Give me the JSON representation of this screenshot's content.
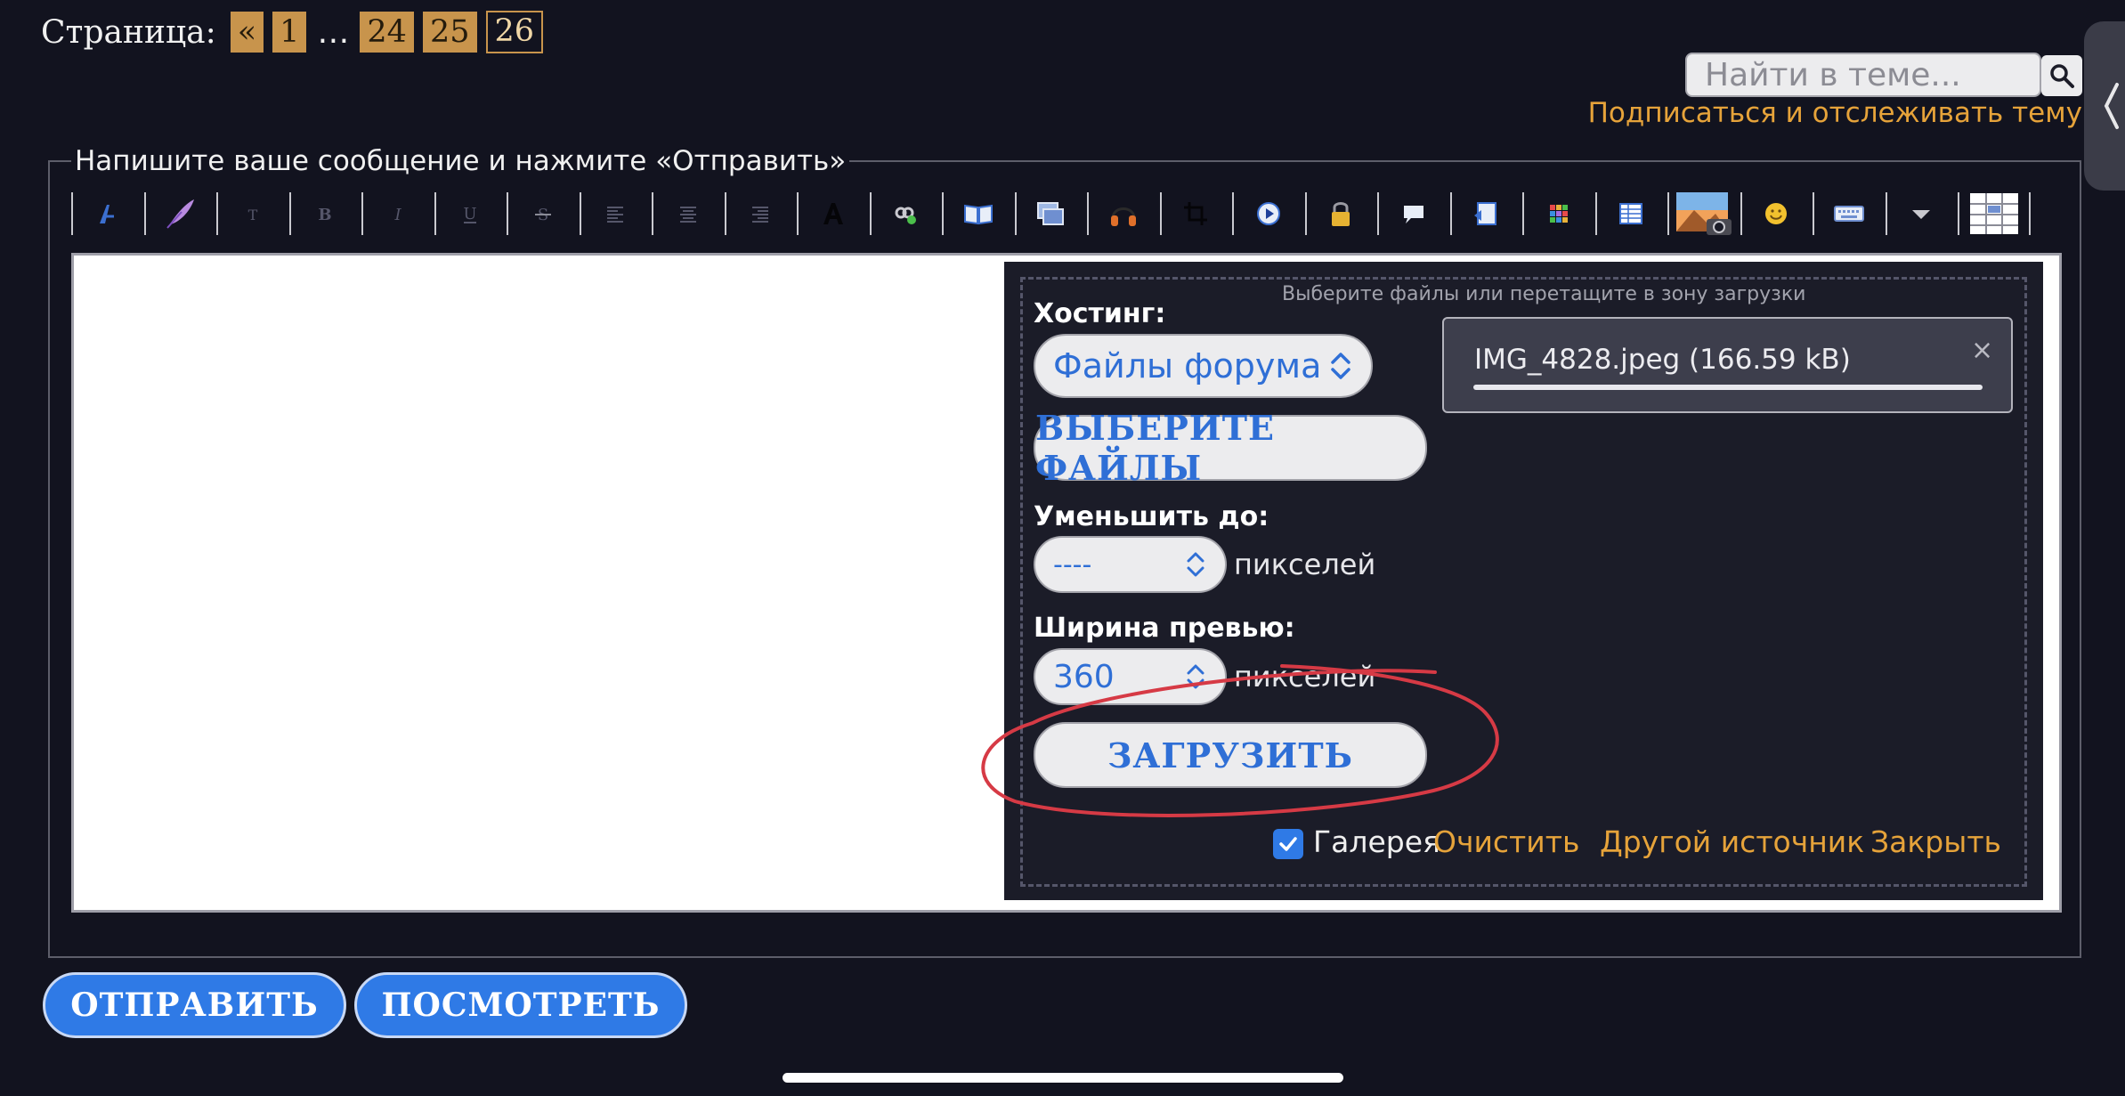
{
  "pagination": {
    "label": "Страница:",
    "prev": "«",
    "pages": [
      "1",
      "…",
      "24",
      "25",
      "26"
    ],
    "current": "26"
  },
  "search": {
    "placeholder": "Найти в теме..."
  },
  "subscribe": {
    "label": "Подписаться и отслеживать тему"
  },
  "form": {
    "legend": "Напишите ваше сообщение и нажмите «Отправить»"
  },
  "toolbar": {
    "icons": [
      "font-style-icon",
      "quill-icon",
      "text-size-icon",
      "bold-icon",
      "italic-icon",
      "underline-icon",
      "strikethrough-icon",
      "align-left-icon",
      "align-center-icon",
      "align-right-icon",
      "font-color-icon",
      "link-icon",
      "book-icon",
      "window-icon",
      "headphones-icon",
      "crop-icon",
      "play-icon",
      "lock-icon",
      "speech-bubble-icon",
      "code-icon",
      "grid-icon",
      "table-icon",
      "photo-icon",
      "smiley-icon",
      "keyboard-icon",
      "dropdown-arrow-icon",
      "layout-grid-icon"
    ]
  },
  "upload": {
    "drop_hint": "Выберите файлы или перетащите в зону загрузки",
    "hosting_label": "Хостинг:",
    "hosting_value": "Файлы форума",
    "choose_files": "ВЫБЕРИТЕ ФАЙЛЫ",
    "resize_label": "Уменьшить до:",
    "resize_value": "----",
    "pixels_unit": "пикселей",
    "preview_label": "Ширина превью:",
    "preview_value": "360",
    "upload_button": "ЗАГРУЗИТЬ",
    "file": {
      "name": "IMG_4828.jpeg (166.59 kB)",
      "close": "×"
    },
    "gallery_label": "Галерея",
    "gallery_checked": true,
    "clear": "Очистить",
    "other_source": "Другой источник",
    "close": "Закрыть"
  },
  "actions": {
    "send": "ОТПРАВИТЬ",
    "preview": "ПОСМОТРЕТЬ"
  },
  "colors": {
    "accent_blue": "#2f7ae6",
    "link_orange": "#e6a33a",
    "page_chip": "#c8944c",
    "background": "#12131f",
    "annotation_red": "#d63a45"
  }
}
